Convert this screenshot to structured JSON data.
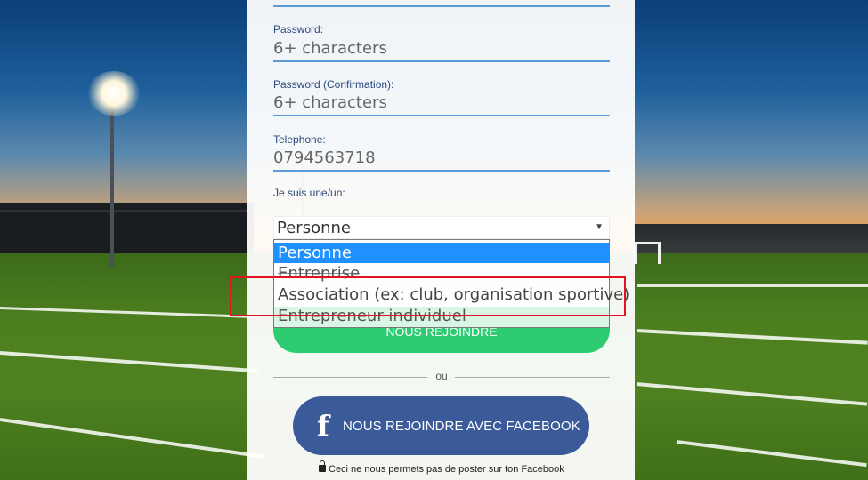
{
  "form": {
    "password": {
      "label": "Password:",
      "placeholder": "6+ characters"
    },
    "password_confirmation": {
      "label": "Password (Confirmation):",
      "placeholder": "6+ characters"
    },
    "telephone": {
      "label": "Telephone:",
      "value": "0794563718"
    },
    "role": {
      "label": "Je suis une/un:",
      "selected": "Personne",
      "options": [
        "Personne",
        "Entreprise",
        "Association (ex: club, organisation sportive)",
        "Entrepreneur individuel"
      ]
    },
    "join_button": "NOUS REJOINDRE",
    "separator": "ou",
    "facebook_button": {
      "icon": "facebook-icon",
      "label": "NOUS REJOINDRE AVEC FACEBOOK"
    },
    "privacy_note": {
      "icon": "lock-icon",
      "text": "Ceci ne nous permets pas de poster sur ton Facebook"
    }
  },
  "colors": {
    "accent_blue": "#5b9bd5",
    "selected_option": "#1e90ff",
    "join_green": "#2ecc71",
    "facebook_blue": "#3b5a9a",
    "highlight_red": "#e0141e"
  }
}
